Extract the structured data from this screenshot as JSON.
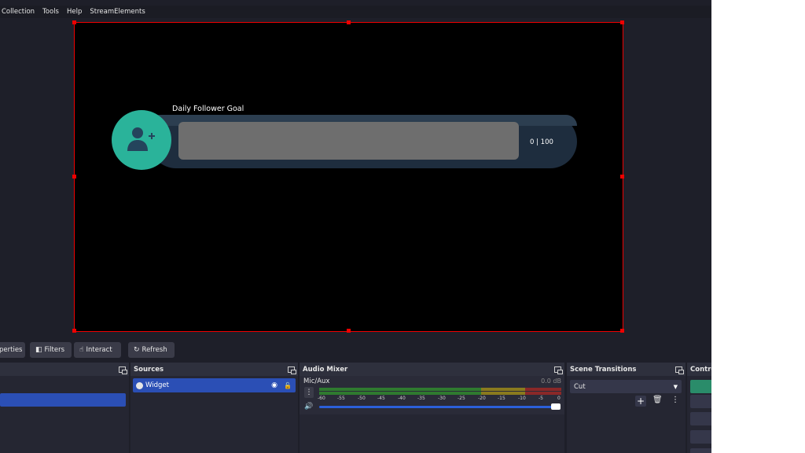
{
  "menu": [
    "Collection",
    "Tools",
    "Help",
    "StreamElements"
  ],
  "widget": {
    "title": "Daily Follower Goal",
    "count": "0 | 100",
    "circle_color": "#2ab39a",
    "track_color": "#6e6e6e"
  },
  "toolbar": {
    "properties_label": "perties",
    "filters_label": "Filters",
    "interact_label": "Interact",
    "refresh_label": "Refresh"
  },
  "docks": {
    "sources": {
      "title": "Sources",
      "item": "Widget"
    },
    "audio_mixer": {
      "title": "Audio Mixer",
      "channel": "Mic/Aux",
      "level": "0.0 dB",
      "ticks": [
        "-60",
        "-55",
        "-50",
        "-45",
        "-40",
        "-35",
        "-30",
        "-25",
        "-20",
        "-15",
        "-10",
        "-5",
        "0"
      ]
    },
    "transitions": {
      "title": "Scene Transitions",
      "selected": "Cut"
    },
    "controls": {
      "title": "Contro"
    }
  },
  "colors": {
    "accent": "#2b4fb5",
    "selection": "#e00000"
  }
}
